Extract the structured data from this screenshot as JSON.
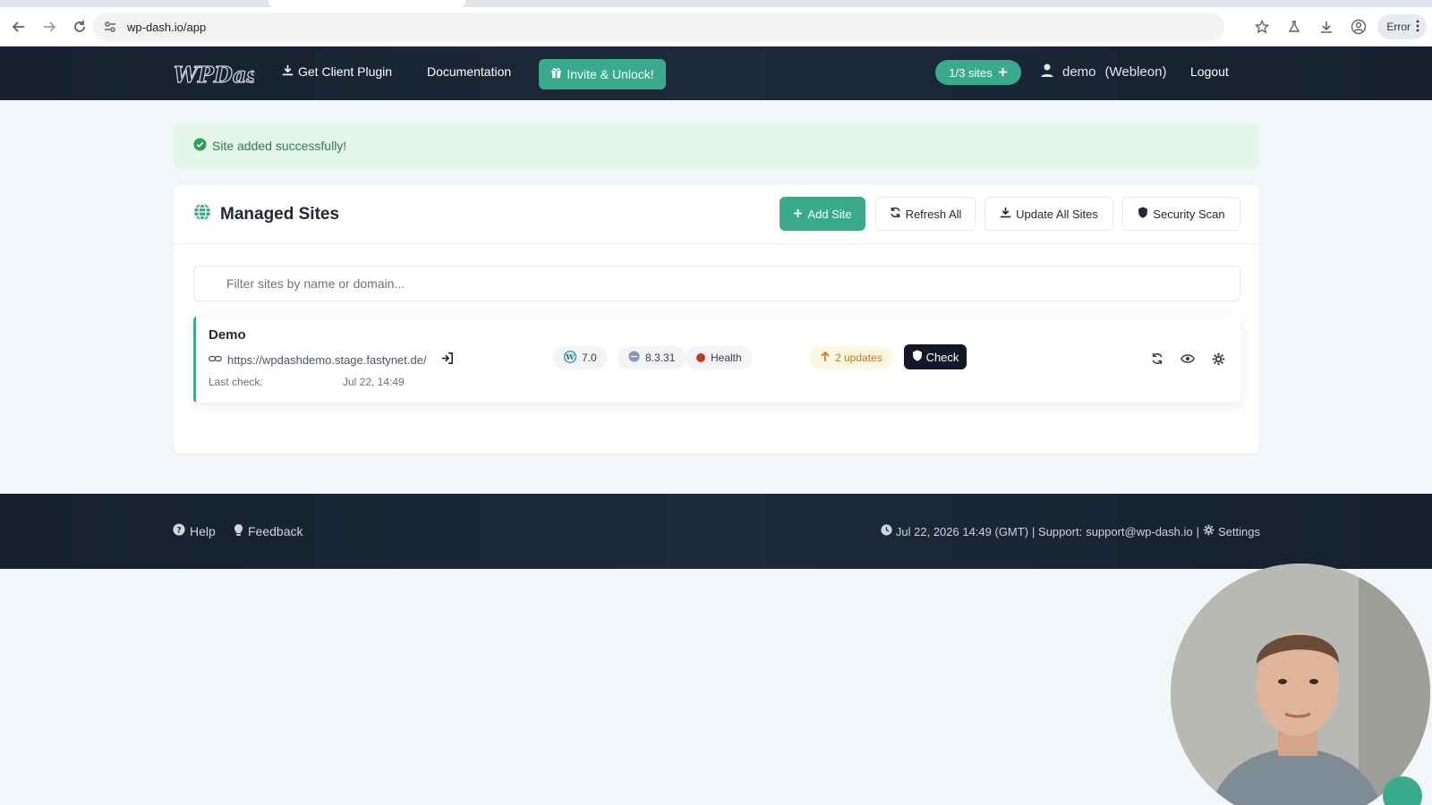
{
  "browser": {
    "url": "wp-dash.io/app",
    "error_label": "Error"
  },
  "nav": {
    "logo_text": "WPDash",
    "get_plugin": "Get Client Plugin",
    "documentation": "Documentation",
    "invite": "Invite & Unlock!",
    "sites_count": "1/3 sites",
    "username": "demo",
    "org": "(Webleon)",
    "logout": "Logout"
  },
  "alert": {
    "message": "Site added successfully!"
  },
  "card": {
    "title": "Managed Sites",
    "add_site": "Add Site",
    "refresh_all": "Refresh All",
    "update_all": "Update All Sites",
    "security_scan": "Security Scan",
    "filter_placeholder": "Filter sites by name or domain..."
  },
  "site": {
    "name": "Demo",
    "url": "https://wpdashdemo.stage.fastynet.de/",
    "last_check_label": "Last check:",
    "last_check_value": "Jul 22, 14:49",
    "wp_version": "7.0",
    "php_version": "8.3.31",
    "health_label": "Health",
    "health_color": "#c0392b",
    "updates": "2 updates",
    "check_label": "Check"
  },
  "footer": {
    "help": "Help",
    "feedback": "Feedback",
    "time": "Jul 22, 2026 14:49 (GMT)",
    "support_label": "| Support:",
    "support_email": "support@wp-dash.io",
    "divider": "|",
    "settings": "Settings"
  },
  "colors": {
    "accent": "#3aaa8c",
    "nav_bg": "#16202e",
    "alert_bg": "#e4f5ea",
    "alert_text": "#2e7d4f"
  },
  "icons": {
    "back": "arrow-left-icon",
    "forward": "arrow-right-icon",
    "reload": "reload-icon",
    "site_settings": "tune-icon",
    "bookmark": "star-icon",
    "labs": "flask-icon",
    "download": "download-icon",
    "profile": "profile-icon",
    "menu": "kebab-icon",
    "globe": "globe-icon",
    "check_circle": "check-circle-icon",
    "link": "link-icon",
    "login": "sign-in-icon",
    "wordpress": "wordpress-icon",
    "php": "php-icon",
    "shield": "shield-icon",
    "sync": "sync-icon",
    "eye": "eye-icon",
    "gear": "gear-icon",
    "gift": "gift-icon",
    "user": "user-icon",
    "question": "question-circle-icon",
    "lightbulb": "lightbulb-icon",
    "clock": "clock-icon"
  }
}
